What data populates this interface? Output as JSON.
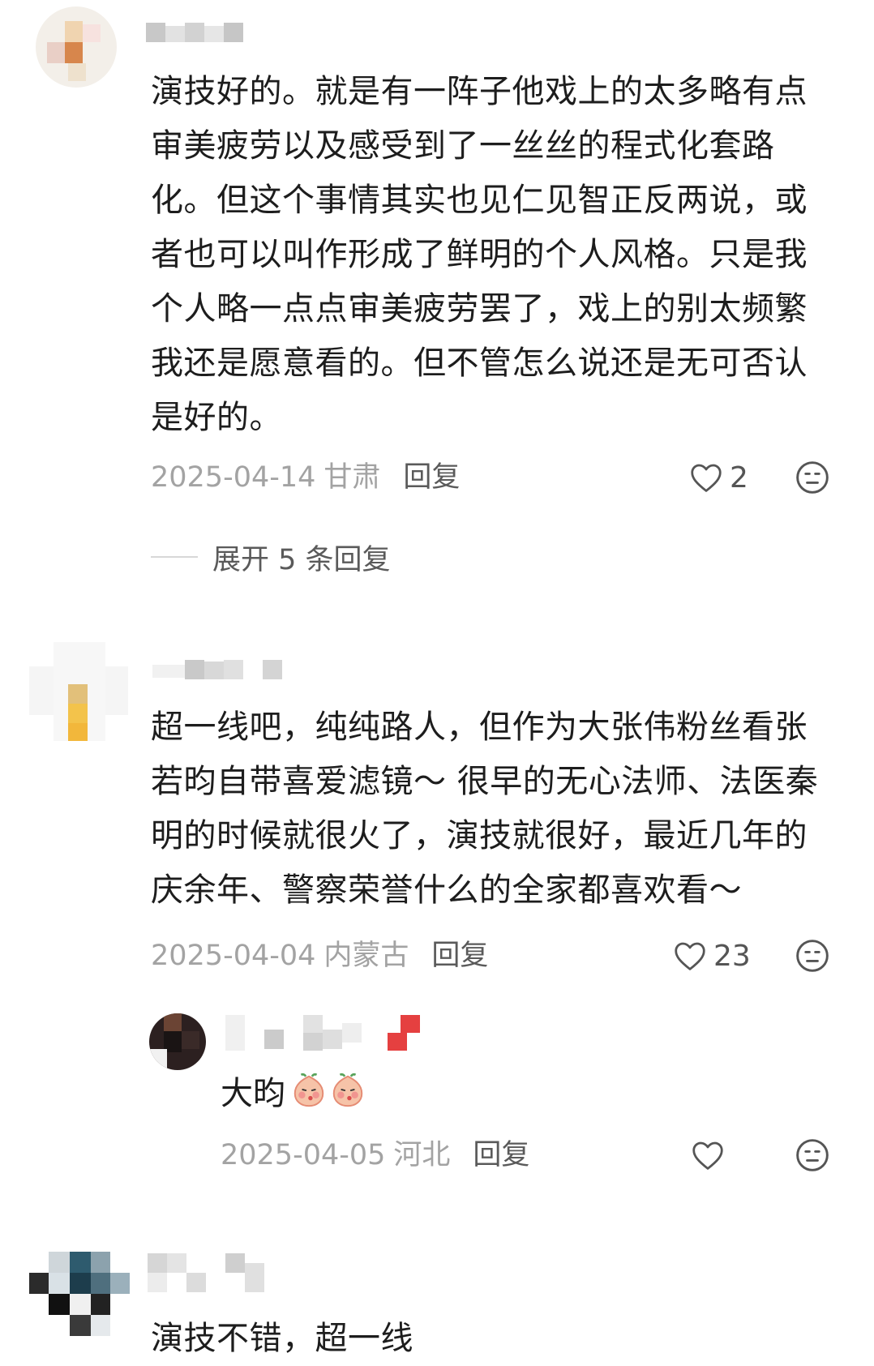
{
  "comments": [
    {
      "text": "演技好的。就是有一阵子他戏上的太多略有点审美疲劳以及感受到了一丝丝的程式化套路化。但这个事情其实也见仁见智正反两说，或者也可以叫作形成了鲜明的个人风格。只是我个人略一点点审美疲劳罢了，戏上的别太频繁我还是愿意看的。但不管怎么说还是无可否认是好的。",
      "date": "2025-04-14",
      "location": "甘肃",
      "reply_label": "回复",
      "likes": "2",
      "expand_label": "展开 5 条回复",
      "icons": {
        "like": "heart-outline-icon",
        "dislike": "meh-face-icon"
      }
    },
    {
      "text": "超一线吧，纯纯路人，但作为大张伟粉丝看张若昀自带喜爱滤镜～ 很早的无心法师、法医秦明的时候就很火了，演技就很好，最近几年的庆余年、警察荣誉什么的全家都喜欢看～",
      "date": "2025-04-04",
      "location": "内蒙古",
      "reply_label": "回复",
      "likes": "23",
      "reply": {
        "text": "大昀",
        "emoji": [
          "blushing-peach-emoji",
          "blushing-peach-emoji"
        ],
        "date": "2025-04-05",
        "location": "河北",
        "reply_label": "回复",
        "likes": ""
      }
    },
    {
      "text": "演技不错，超一线"
    }
  ],
  "colors": {
    "text": "#1d1d1d",
    "meta": "#a3a3a3",
    "action": "#5a5a5a"
  }
}
